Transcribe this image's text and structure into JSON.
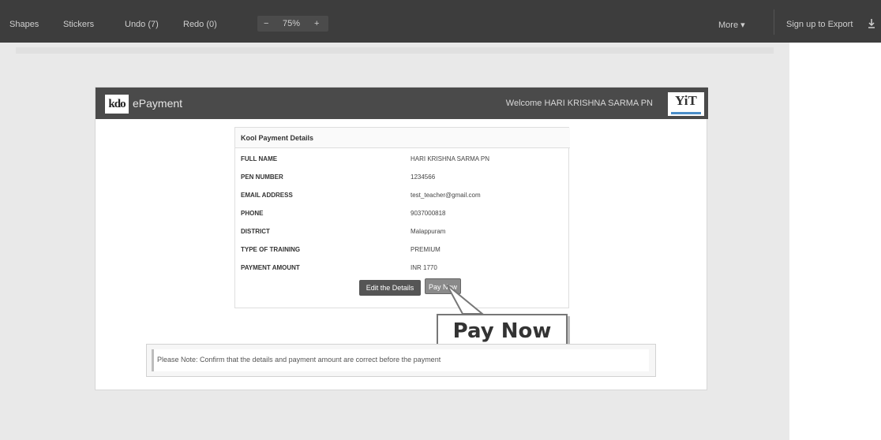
{
  "toolbar": {
    "shapes": "Shapes",
    "stickers": "Stickers",
    "undo": "Undo (7)",
    "redo": "Redo (0)",
    "zoom_minus": "−",
    "zoom_value": "75%",
    "zoom_plus": "+",
    "more": "More ▾",
    "signup": "Sign up to Export"
  },
  "app": {
    "logo_text": "kdo",
    "title": "ePayment",
    "welcome": "Welcome HARI KRISHNA SARMA PN",
    "right_logo": "YiT"
  },
  "details": {
    "heading": "Kool Payment Details",
    "rows": [
      {
        "label": "FULL NAME",
        "value": "HARI KRISHNA SARMA PN"
      },
      {
        "label": "PEN NUMBER",
        "value": "1234566"
      },
      {
        "label": "EMAIL ADDRESS",
        "value": "test_teacher@gmail.com"
      },
      {
        "label": "PHONE",
        "value": "9037000818"
      },
      {
        "label": "DISTRICT",
        "value": "Malappuram"
      },
      {
        "label": "TYPE OF TRAINING",
        "value": "PREMIUM"
      },
      {
        "label": "PAYMENT AMOUNT",
        "value": "INR 1770"
      }
    ]
  },
  "buttons": {
    "edit": "Edit the Details",
    "pay": "Pay Now"
  },
  "callout": "Pay Now",
  "note": "Please Note: Confirm that the details and payment amount are correct before the payment",
  "colors": {
    "toolbar": "#3d3d3d",
    "app_header": "#4a4a4a",
    "page_bg": "#e9e9e9"
  }
}
